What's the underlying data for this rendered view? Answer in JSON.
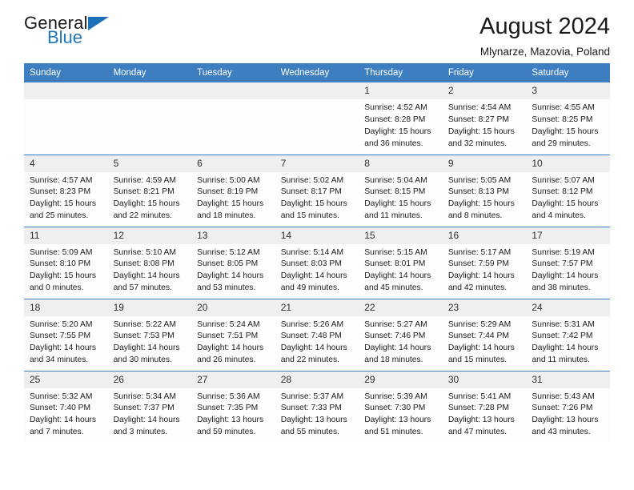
{
  "brand": {
    "name_top": "General",
    "name_bottom": "Blue",
    "accent_color": "#2177bb"
  },
  "header": {
    "title": "August 2024",
    "subtitle": "Mlynarze, Mazovia, Poland"
  },
  "theme": {
    "header_row_bg": "#3c7ebf",
    "daynum_bg": "#efefef",
    "cell_bg": "#fdfdfd",
    "text": "#1c1c1c"
  },
  "weekday_headers": [
    "Sunday",
    "Monday",
    "Tuesday",
    "Wednesday",
    "Thursday",
    "Friday",
    "Saturday"
  ],
  "labels": {
    "sunrise_prefix": "Sunrise:",
    "sunset_prefix": "Sunset:",
    "daylight_prefix": "Daylight:"
  },
  "weeks": [
    [
      {
        "day": "",
        "empty": true
      },
      {
        "day": "",
        "empty": true
      },
      {
        "day": "",
        "empty": true
      },
      {
        "day": "",
        "empty": true
      },
      {
        "day": "1",
        "sunrise": "Sunrise: 4:52 AM",
        "sunset": "Sunset: 8:28 PM",
        "daylight": "Daylight: 15 hours and 36 minutes."
      },
      {
        "day": "2",
        "sunrise": "Sunrise: 4:54 AM",
        "sunset": "Sunset: 8:27 PM",
        "daylight": "Daylight: 15 hours and 32 minutes."
      },
      {
        "day": "3",
        "sunrise": "Sunrise: 4:55 AM",
        "sunset": "Sunset: 8:25 PM",
        "daylight": "Daylight: 15 hours and 29 minutes."
      }
    ],
    [
      {
        "day": "4",
        "sunrise": "Sunrise: 4:57 AM",
        "sunset": "Sunset: 8:23 PM",
        "daylight": "Daylight: 15 hours and 25 minutes."
      },
      {
        "day": "5",
        "sunrise": "Sunrise: 4:59 AM",
        "sunset": "Sunset: 8:21 PM",
        "daylight": "Daylight: 15 hours and 22 minutes."
      },
      {
        "day": "6",
        "sunrise": "Sunrise: 5:00 AM",
        "sunset": "Sunset: 8:19 PM",
        "daylight": "Daylight: 15 hours and 18 minutes."
      },
      {
        "day": "7",
        "sunrise": "Sunrise: 5:02 AM",
        "sunset": "Sunset: 8:17 PM",
        "daylight": "Daylight: 15 hours and 15 minutes."
      },
      {
        "day": "8",
        "sunrise": "Sunrise: 5:04 AM",
        "sunset": "Sunset: 8:15 PM",
        "daylight": "Daylight: 15 hours and 11 minutes."
      },
      {
        "day": "9",
        "sunrise": "Sunrise: 5:05 AM",
        "sunset": "Sunset: 8:13 PM",
        "daylight": "Daylight: 15 hours and 8 minutes."
      },
      {
        "day": "10",
        "sunrise": "Sunrise: 5:07 AM",
        "sunset": "Sunset: 8:12 PM",
        "daylight": "Daylight: 15 hours and 4 minutes."
      }
    ],
    [
      {
        "day": "11",
        "sunrise": "Sunrise: 5:09 AM",
        "sunset": "Sunset: 8:10 PM",
        "daylight": "Daylight: 15 hours and 0 minutes."
      },
      {
        "day": "12",
        "sunrise": "Sunrise: 5:10 AM",
        "sunset": "Sunset: 8:08 PM",
        "daylight": "Daylight: 14 hours and 57 minutes."
      },
      {
        "day": "13",
        "sunrise": "Sunrise: 5:12 AM",
        "sunset": "Sunset: 8:05 PM",
        "daylight": "Daylight: 14 hours and 53 minutes."
      },
      {
        "day": "14",
        "sunrise": "Sunrise: 5:14 AM",
        "sunset": "Sunset: 8:03 PM",
        "daylight": "Daylight: 14 hours and 49 minutes."
      },
      {
        "day": "15",
        "sunrise": "Sunrise: 5:15 AM",
        "sunset": "Sunset: 8:01 PM",
        "daylight": "Daylight: 14 hours and 45 minutes."
      },
      {
        "day": "16",
        "sunrise": "Sunrise: 5:17 AM",
        "sunset": "Sunset: 7:59 PM",
        "daylight": "Daylight: 14 hours and 42 minutes."
      },
      {
        "day": "17",
        "sunrise": "Sunrise: 5:19 AM",
        "sunset": "Sunset: 7:57 PM",
        "daylight": "Daylight: 14 hours and 38 minutes."
      }
    ],
    [
      {
        "day": "18",
        "sunrise": "Sunrise: 5:20 AM",
        "sunset": "Sunset: 7:55 PM",
        "daylight": "Daylight: 14 hours and 34 minutes."
      },
      {
        "day": "19",
        "sunrise": "Sunrise: 5:22 AM",
        "sunset": "Sunset: 7:53 PM",
        "daylight": "Daylight: 14 hours and 30 minutes."
      },
      {
        "day": "20",
        "sunrise": "Sunrise: 5:24 AM",
        "sunset": "Sunset: 7:51 PM",
        "daylight": "Daylight: 14 hours and 26 minutes."
      },
      {
        "day": "21",
        "sunrise": "Sunrise: 5:26 AM",
        "sunset": "Sunset: 7:48 PM",
        "daylight": "Daylight: 14 hours and 22 minutes."
      },
      {
        "day": "22",
        "sunrise": "Sunrise: 5:27 AM",
        "sunset": "Sunset: 7:46 PM",
        "daylight": "Daylight: 14 hours and 18 minutes."
      },
      {
        "day": "23",
        "sunrise": "Sunrise: 5:29 AM",
        "sunset": "Sunset: 7:44 PM",
        "daylight": "Daylight: 14 hours and 15 minutes."
      },
      {
        "day": "24",
        "sunrise": "Sunrise: 5:31 AM",
        "sunset": "Sunset: 7:42 PM",
        "daylight": "Daylight: 14 hours and 11 minutes."
      }
    ],
    [
      {
        "day": "25",
        "sunrise": "Sunrise: 5:32 AM",
        "sunset": "Sunset: 7:40 PM",
        "daylight": "Daylight: 14 hours and 7 minutes."
      },
      {
        "day": "26",
        "sunrise": "Sunrise: 5:34 AM",
        "sunset": "Sunset: 7:37 PM",
        "daylight": "Daylight: 14 hours and 3 minutes."
      },
      {
        "day": "27",
        "sunrise": "Sunrise: 5:36 AM",
        "sunset": "Sunset: 7:35 PM",
        "daylight": "Daylight: 13 hours and 59 minutes."
      },
      {
        "day": "28",
        "sunrise": "Sunrise: 5:37 AM",
        "sunset": "Sunset: 7:33 PM",
        "daylight": "Daylight: 13 hours and 55 minutes."
      },
      {
        "day": "29",
        "sunrise": "Sunrise: 5:39 AM",
        "sunset": "Sunset: 7:30 PM",
        "daylight": "Daylight: 13 hours and 51 minutes."
      },
      {
        "day": "30",
        "sunrise": "Sunrise: 5:41 AM",
        "sunset": "Sunset: 7:28 PM",
        "daylight": "Daylight: 13 hours and 47 minutes."
      },
      {
        "day": "31",
        "sunrise": "Sunrise: 5:43 AM",
        "sunset": "Sunset: 7:26 PM",
        "daylight": "Daylight: 13 hours and 43 minutes."
      }
    ]
  ]
}
